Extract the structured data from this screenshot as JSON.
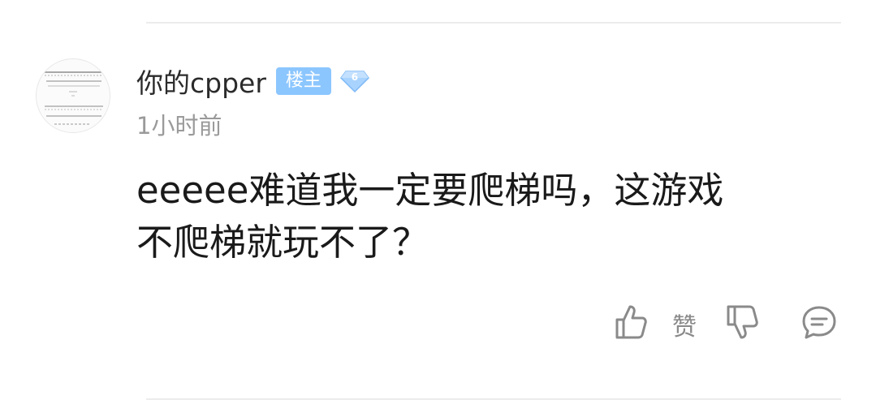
{
  "comment": {
    "username": "你的cpper",
    "op_badge": "楼主",
    "level": "6",
    "time": "1小时前",
    "text": "eeeee难道我一定要爬梯吗，这游戏不爬梯就玩不了？",
    "line1": "eeeee难道我一定要爬梯吗，这游戏",
    "line2": "不爬梯就玩不了？"
  },
  "actions": {
    "like_label": "赞",
    "like_icon": "thumbs-up-icon",
    "dislike_icon": "thumbs-down-icon",
    "reply_icon": "comment-bubble-icon"
  },
  "colors": {
    "op_badge_bg": "#8cc6ff",
    "level_badge": "#9ecbff",
    "text": "#1a1a1a",
    "muted": "#9a9a9a",
    "icon": "#8a8a8a"
  }
}
